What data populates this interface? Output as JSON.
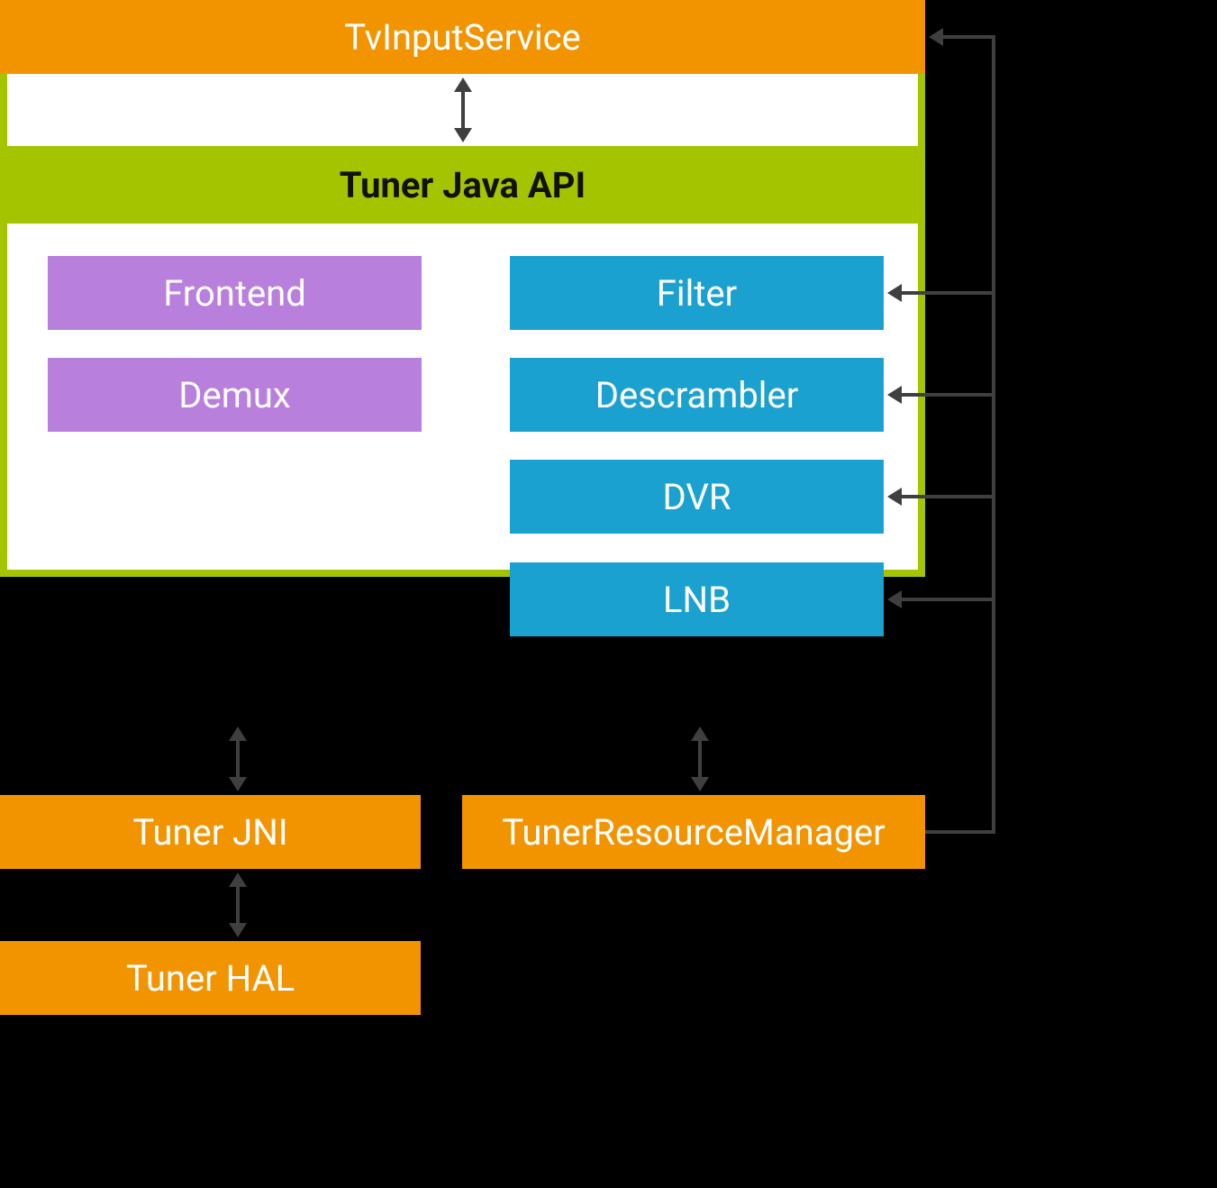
{
  "tv_input_service": "TvInputService",
  "tuner_java_api_title": "Tuner Java API",
  "left_modules": {
    "frontend": "Frontend",
    "demux": "Demux"
  },
  "right_modules": {
    "filter": "Filter",
    "descrambler": "Descrambler",
    "dvr": "DVR",
    "lnb": "LNB"
  },
  "tuner_jni": "Tuner JNI",
  "tuner_resource_manager": "TunerResourceManager",
  "tuner_hal": "Tuner HAL",
  "colors": {
    "orange": "#f29400",
    "green": "#a4c400",
    "purple": "#b97fdc",
    "cyan": "#1ba1d0",
    "arrow": "#3f3f3f"
  }
}
